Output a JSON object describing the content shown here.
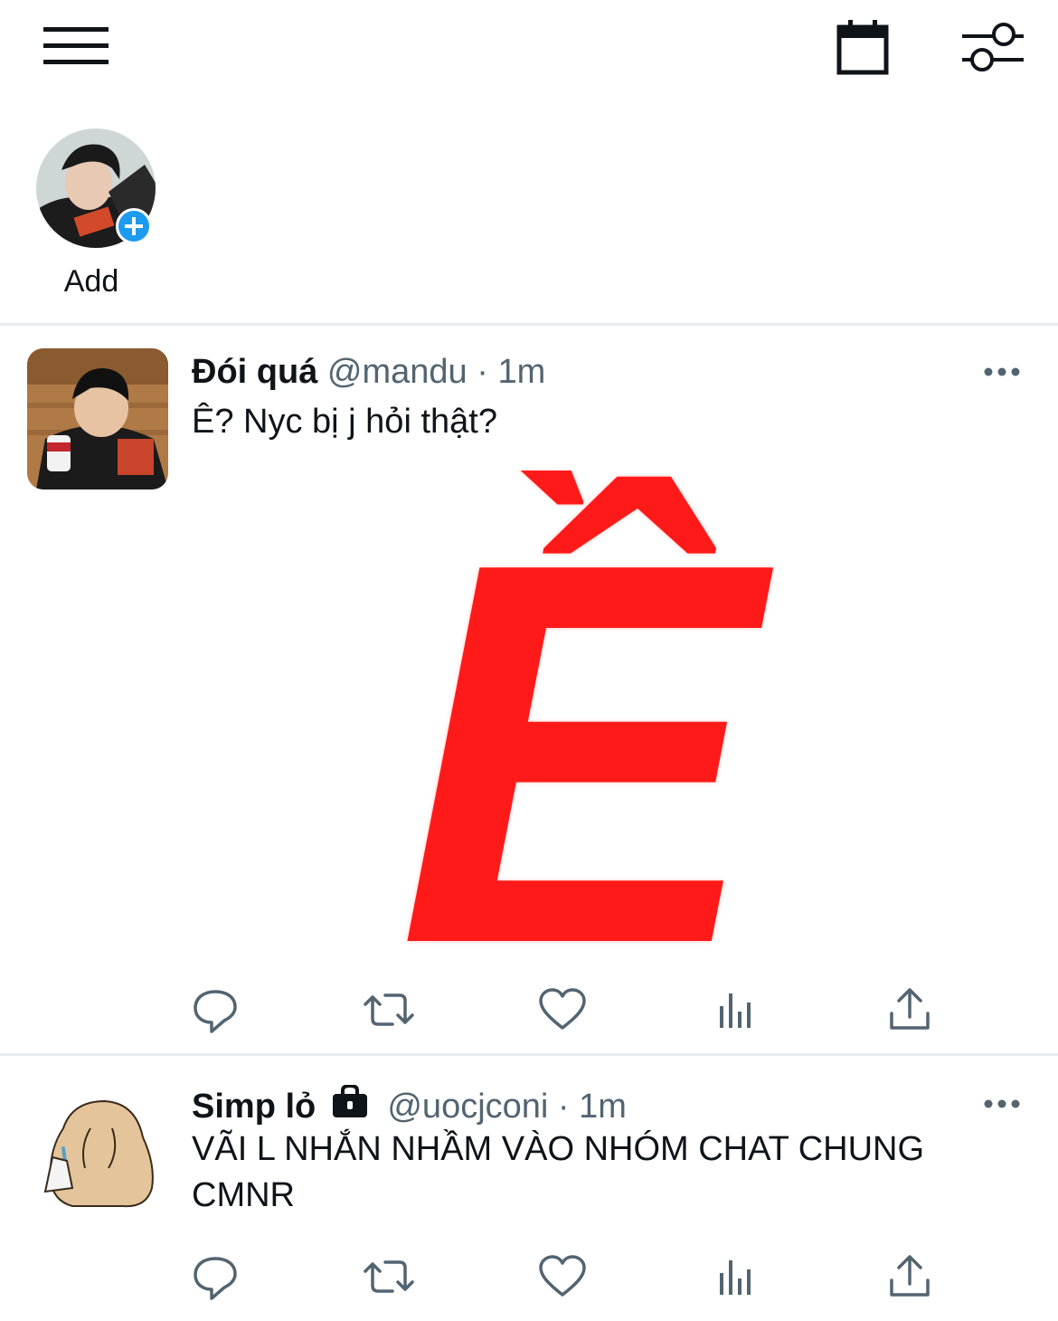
{
  "topbar": {
    "menu_icon": "hamburger-menu-icon",
    "calendar_icon": "calendar-icon",
    "settings_icon": "sliders-icon"
  },
  "stories": {
    "items": [
      {
        "label": "Add",
        "icon": "plus-icon"
      }
    ]
  },
  "tweets": [
    {
      "name": "Đói quá",
      "handle": "@mandu",
      "dot": "·",
      "time": "1m",
      "text": "Ê? Nyc bị j hỏi thật?",
      "media_text": "Ề",
      "media_color": "#ff1a1a",
      "more_icon": "ellipsis-icon"
    },
    {
      "name": "Simp lỏ",
      "protected_icon": "lock-icon",
      "handle": "@uocjconi",
      "dot": "·",
      "time": "1m",
      "text": "VÃI L NHẮN NHẦM VÀO NHÓM CHAT CHUNG CMNR",
      "more_icon": "ellipsis-icon"
    }
  ],
  "actions": {
    "icons": [
      "reply-icon",
      "retweet-icon",
      "like-icon",
      "analytics-icon",
      "share-icon"
    ],
    "color": "#536471"
  },
  "colors": {
    "accent": "#1d9bf0",
    "text": "#0f1419",
    "secondary": "#536471",
    "divider": "#e6ecf0"
  }
}
